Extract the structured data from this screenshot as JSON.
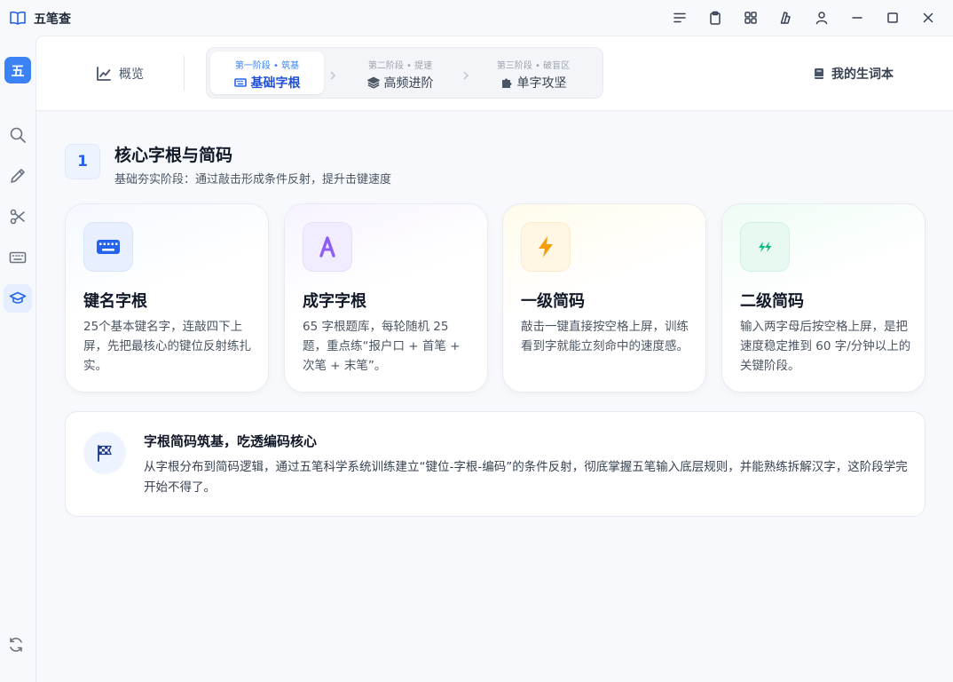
{
  "app": {
    "title": "五笔查",
    "icon": "open-book-icon",
    "logo_char": "五"
  },
  "titlebar": {
    "buttons": [
      "menu-icon",
      "clipboard-icon",
      "grid-icon",
      "theme-icon",
      "user-icon",
      "minimize-icon",
      "maximize-icon",
      "close-icon"
    ]
  },
  "sidebar": {
    "items": [
      "search-icon",
      "pencil-icon",
      "scissors-icon",
      "keyboard-icon",
      "graduation-cap-icon"
    ],
    "active": "graduation-cap-icon",
    "bottom": "refresh-icon"
  },
  "nav": {
    "overview_label": "概览",
    "stages": [
      {
        "sub": "第一阶段 • 筑基",
        "label": "基础字根",
        "icon": "keyboard-icon",
        "active": true
      },
      {
        "sub": "第二阶段 • 提速",
        "label": "高频进阶",
        "icon": "layers-icon",
        "active": false
      },
      {
        "sub": "第三阶段 • 破盲区",
        "label": "单字攻坚",
        "icon": "puzzle-icon",
        "active": false
      }
    ],
    "vocab_label": "我的生词本"
  },
  "section": {
    "number": "1",
    "title": "核心字根与简码",
    "subtitle": "基础夯实阶段：通过敲击形成条件反射，提升击键速度"
  },
  "cards": [
    {
      "title": "键名字根",
      "desc": "25个基本键名字，连敲四下上屏，先把最核心的键位反射练扎实。",
      "icon": "keyboard-icon",
      "color": "#2563eb",
      "bg": "#eaf1ff"
    },
    {
      "title": "成字字根",
      "desc": "65 字根题库，每轮随机 25 题，重点练“报户口 + 首笔 + 次笔 + 末笔”。",
      "icon": "letter-a-icon",
      "color": "#7c3aed",
      "bg": "#f3eeff"
    },
    {
      "title": "一级简码",
      "desc": "敲击一键直接按空格上屏，训练看到字就能立刻命中的速度感。",
      "icon": "lightning-icon",
      "color": "#f59e0b",
      "bg": "#fff7e6"
    },
    {
      "title": "二级简码",
      "desc": "输入两字母后按空格上屏，是把速度稳定推到 60 字/分钟以上的关键阶段。",
      "icon": "double-lightning-icon",
      "color": "#10b981",
      "bg": "#e8faf2"
    }
  ],
  "banner": {
    "title": "字根简码筑基，吃透编码核心",
    "desc": "从字根分布到简码逻辑，通过五笔科学系统训练建立“键位-字根-编码”的条件反射，彻底掌握五笔输入底层规则，并能熟练拆解汉字，这阶段学完开始不得了。",
    "icon": "checkered-flag-icon"
  }
}
